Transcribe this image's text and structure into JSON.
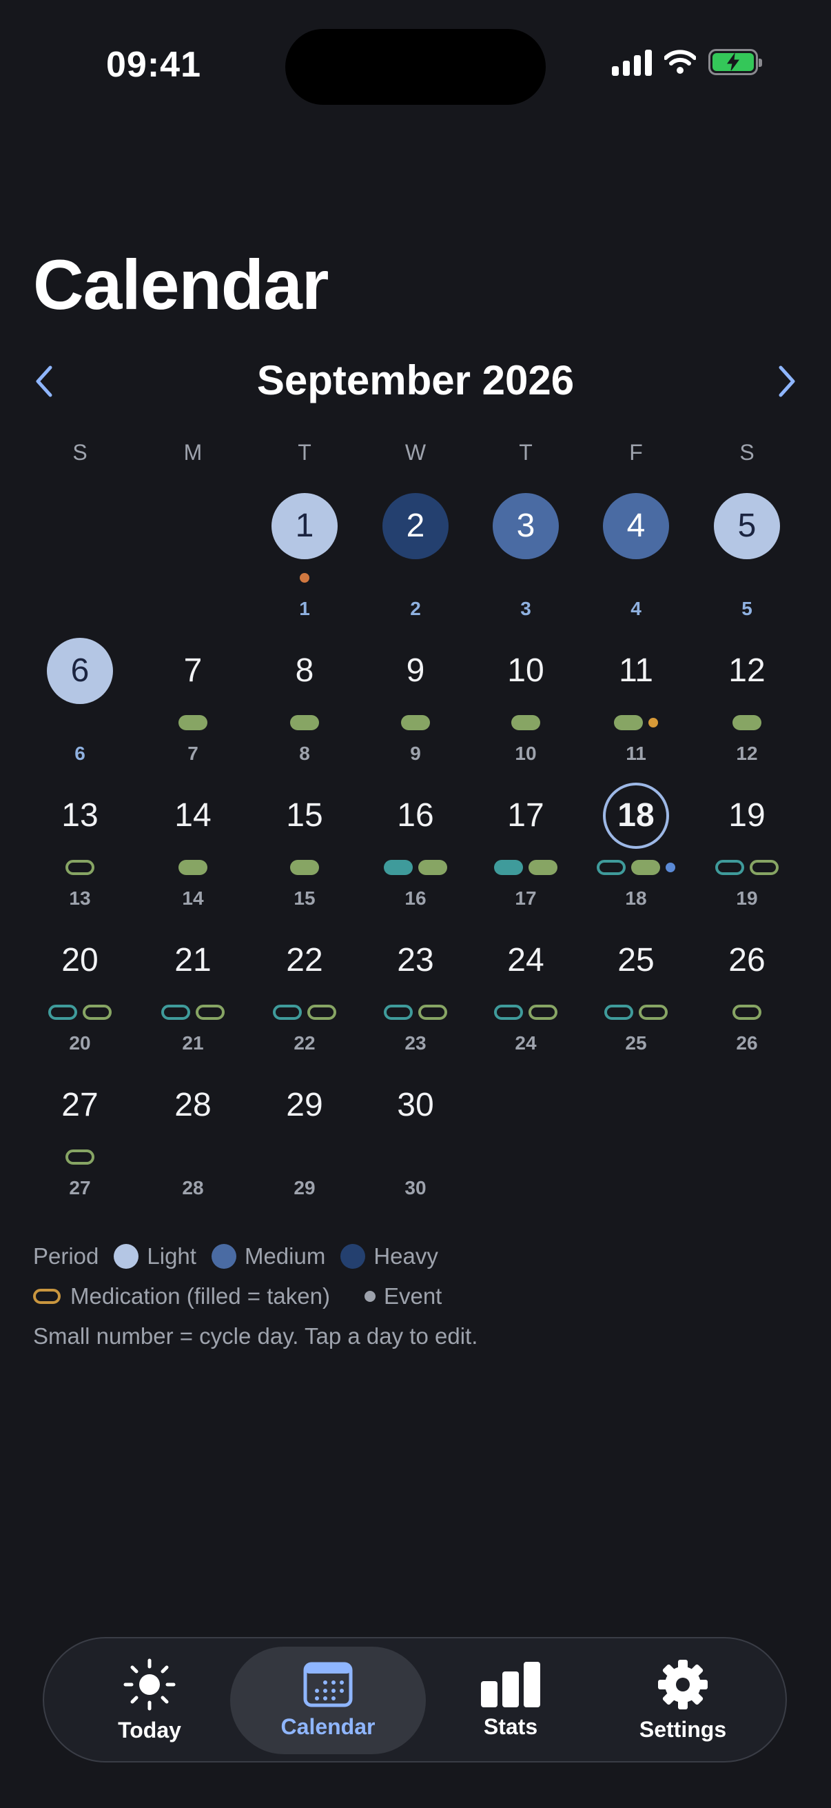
{
  "status_bar": {
    "time": "09:41"
  },
  "page": {
    "title": "Calendar"
  },
  "calendar": {
    "month_label": "September 2026",
    "weekdays": [
      "S",
      "M",
      "T",
      "W",
      "T",
      "F",
      "S"
    ],
    "days": [
      {
        "day": "1",
        "cycle": "1",
        "period": "light",
        "med": [],
        "event": "orange"
      },
      {
        "day": "2",
        "cycle": "2",
        "period": "heavy",
        "med": [],
        "event": null
      },
      {
        "day": "3",
        "cycle": "3",
        "period": "medium",
        "med": [],
        "event": null
      },
      {
        "day": "4",
        "cycle": "4",
        "period": "medium",
        "med": [],
        "event": null
      },
      {
        "day": "5",
        "cycle": "5",
        "period": "light",
        "med": [],
        "event": null
      },
      {
        "day": "6",
        "cycle": "6",
        "period": "light",
        "med": [],
        "event": null
      },
      {
        "day": "7",
        "cycle": "7",
        "period": null,
        "med": [
          "green-filled"
        ],
        "event": null
      },
      {
        "day": "8",
        "cycle": "8",
        "period": null,
        "med": [
          "green-filled"
        ],
        "event": null
      },
      {
        "day": "9",
        "cycle": "9",
        "period": null,
        "med": [
          "green-filled"
        ],
        "event": null
      },
      {
        "day": "10",
        "cycle": "10",
        "period": null,
        "med": [
          "green-filled"
        ],
        "event": null
      },
      {
        "day": "11",
        "cycle": "11",
        "period": null,
        "med": [
          "green-filled"
        ],
        "event": "amber"
      },
      {
        "day": "12",
        "cycle": "12",
        "period": null,
        "med": [
          "green-filled"
        ],
        "event": null
      },
      {
        "day": "13",
        "cycle": "13",
        "period": null,
        "med": [
          "green-outline"
        ],
        "event": null
      },
      {
        "day": "14",
        "cycle": "14",
        "period": null,
        "med": [
          "green-filled"
        ],
        "event": null
      },
      {
        "day": "15",
        "cycle": "15",
        "period": null,
        "med": [
          "green-filled"
        ],
        "event": null
      },
      {
        "day": "16",
        "cycle": "16",
        "period": null,
        "med": [
          "teal-filled",
          "green-filled"
        ],
        "event": null
      },
      {
        "day": "17",
        "cycle": "17",
        "period": null,
        "med": [
          "teal-filled",
          "green-filled"
        ],
        "event": null
      },
      {
        "day": "18",
        "cycle": "18",
        "period": null,
        "med": [
          "teal-outline",
          "green-filled"
        ],
        "event": "blue",
        "today": true
      },
      {
        "day": "19",
        "cycle": "19",
        "period": null,
        "med": [
          "teal-outline",
          "green-outline"
        ],
        "event": null
      },
      {
        "day": "20",
        "cycle": "20",
        "period": null,
        "med": [
          "teal-outline",
          "green-outline"
        ],
        "event": null
      },
      {
        "day": "21",
        "cycle": "21",
        "period": null,
        "med": [
          "teal-outline",
          "green-outline"
        ],
        "event": null
      },
      {
        "day": "22",
        "cycle": "22",
        "period": null,
        "med": [
          "teal-outline",
          "green-outline"
        ],
        "event": null
      },
      {
        "day": "23",
        "cycle": "23",
        "period": null,
        "med": [
          "teal-outline",
          "green-outline"
        ],
        "event": null
      },
      {
        "day": "24",
        "cycle": "24",
        "period": null,
        "med": [
          "teal-outline",
          "green-outline"
        ],
        "event": null
      },
      {
        "day": "25",
        "cycle": "25",
        "period": null,
        "med": [
          "teal-outline",
          "green-outline"
        ],
        "event": null
      },
      {
        "day": "26",
        "cycle": "26",
        "period": null,
        "med": [
          "green-outline"
        ],
        "event": null
      },
      {
        "day": "27",
        "cycle": "27",
        "period": null,
        "med": [
          "green-outline"
        ],
        "event": null
      },
      {
        "day": "28",
        "cycle": "28",
        "period": null,
        "med": [],
        "event": null
      },
      {
        "day": "29",
        "cycle": "29",
        "period": null,
        "med": [],
        "event": null
      },
      {
        "day": "30",
        "cycle": "30",
        "period": null,
        "med": [],
        "event": null
      }
    ]
  },
  "legend": {
    "period_label": "Period",
    "light_label": "Light",
    "medium_label": "Medium",
    "heavy_label": "Heavy",
    "medication_label": "Medication (filled = taken)",
    "event_label": "Event",
    "hint": "Small number = cycle day. Tap a day to edit."
  },
  "tabs": [
    {
      "label": "Today",
      "icon": "sun-icon"
    },
    {
      "label": "Calendar",
      "icon": "calendar-icon",
      "active": true
    },
    {
      "label": "Stats",
      "icon": "bar-chart-icon"
    },
    {
      "label": "Settings",
      "icon": "gear-icon"
    }
  ],
  "colors": {
    "background": "#16171c",
    "accent": "#8fb6ff",
    "period_light": "#b4c6e4",
    "period_medium": "#4a6ba3",
    "period_heavy": "#24406f",
    "med_green": "#87a564",
    "med_teal": "#3f9b9b",
    "event_orange": "#d07840",
    "event_amber": "#d79a38",
    "event_blue": "#5b8ad6"
  }
}
